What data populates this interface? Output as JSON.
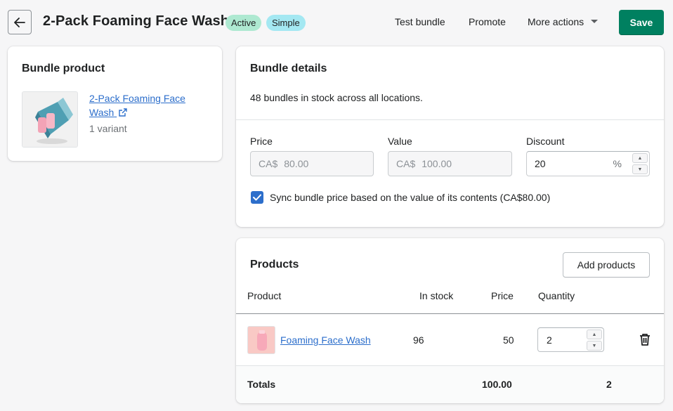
{
  "header": {
    "title": "2-Pack Foaming Face Wash",
    "badges": {
      "status": "Active",
      "type": "Simple"
    },
    "actions": {
      "test": "Test bundle",
      "promote": "Promote",
      "more": "More actions"
    },
    "save_label": "Save"
  },
  "bundle_product": {
    "title": "Bundle product",
    "product_name": "2-Pack Foaming Face Wash",
    "variant_count": "1 variant"
  },
  "bundle_details": {
    "title": "Bundle details",
    "stock_text": "48 bundles in stock across all locations.",
    "price": {
      "label": "Price",
      "prefix": "CA$",
      "value": "80.00"
    },
    "value": {
      "label": "Value",
      "prefix": "CA$",
      "value": "100.00"
    },
    "discount": {
      "label": "Discount",
      "value": "20",
      "suffix": "%"
    },
    "sync": {
      "checked": true,
      "label": "Sync bundle price based on the value of its contents (CA$80.00)"
    }
  },
  "products": {
    "title": "Products",
    "add_label": "Add products",
    "columns": [
      "Product",
      "In stock",
      "Price",
      "Quantity"
    ],
    "rows": [
      {
        "name": "Foaming Face Wash",
        "in_stock": "96",
        "price": "50",
        "quantity": "2"
      }
    ],
    "totals": {
      "label": "Totals",
      "price": "100.00",
      "quantity": "2"
    }
  },
  "colors": {
    "primary": "#008060",
    "link": "#2c6ecb",
    "badge_active": "#aee9d1",
    "badge_simple": "#a4e8f2",
    "background": "#f6f6f7"
  },
  "icons": {
    "back": "arrow-left-icon",
    "more": "caret-down-icon",
    "external": "external-link-icon",
    "check": "checkmark-icon",
    "delete": "trash-icon"
  }
}
